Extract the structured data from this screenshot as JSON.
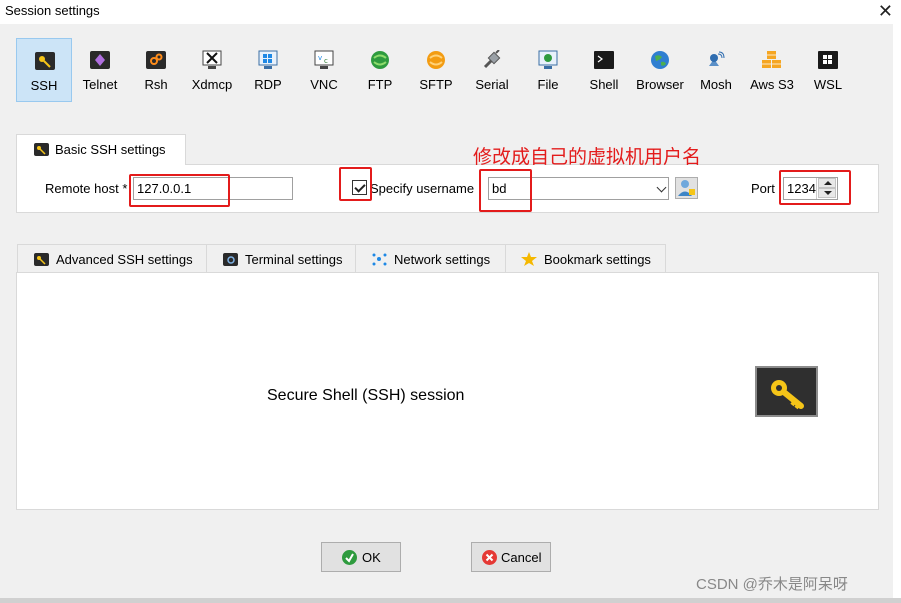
{
  "window": {
    "title": "Session settings",
    "close_glyph": "✕"
  },
  "session_types": [
    {
      "label": "SSH",
      "icon": "ssh-key-icon",
      "selected": true
    },
    {
      "label": "Telnet",
      "icon": "telnet-icon"
    },
    {
      "label": "Rsh",
      "icon": "rsh-icon"
    },
    {
      "label": "Xdmcp",
      "icon": "xdmcp-icon"
    },
    {
      "label": "RDP",
      "icon": "rdp-icon"
    },
    {
      "label": "VNC",
      "icon": "vnc-icon"
    },
    {
      "label": "FTP",
      "icon": "ftp-icon"
    },
    {
      "label": "SFTP",
      "icon": "sftp-icon"
    },
    {
      "label": "Serial",
      "icon": "serial-icon"
    },
    {
      "label": "File",
      "icon": "file-icon"
    },
    {
      "label": "Shell",
      "icon": "shell-icon"
    },
    {
      "label": "Browser",
      "icon": "browser-icon"
    },
    {
      "label": "Mosh",
      "icon": "mosh-icon"
    },
    {
      "label": "Aws S3",
      "icon": "aws-s3-icon"
    },
    {
      "label": "WSL",
      "icon": "wsl-icon"
    }
  ],
  "basic": {
    "tab_label": "Basic SSH settings",
    "remote_host_label": "Remote host *",
    "remote_host_value": "127.0.0.1",
    "specify_username_label": "Specify username",
    "specify_username_checked": true,
    "username_value": "bd",
    "port_label": "Port",
    "port_value": "1234"
  },
  "annotation": {
    "text": "修改成自己的虚拟机用户名",
    "color": "#e31b1b"
  },
  "tabs": [
    {
      "label": "Advanced SSH settings"
    },
    {
      "label": "Terminal settings"
    },
    {
      "label": "Network settings"
    },
    {
      "label": "Bookmark settings"
    }
  ],
  "main": {
    "description": "Secure Shell (SSH) session"
  },
  "buttons": {
    "ok": "OK",
    "cancel": "Cancel"
  },
  "watermark": "CSDN @乔木是阿呆呀",
  "colors": {
    "selected_bg": "#cce4f7",
    "highlight": "#e31b1b",
    "key_yellow": "#f5c518"
  }
}
